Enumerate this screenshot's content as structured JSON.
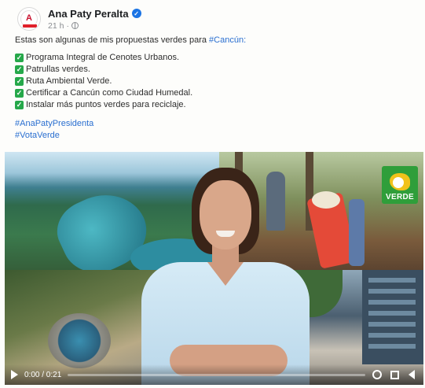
{
  "post": {
    "author": "Ana Paty Peralta",
    "timestamp": "21 h",
    "avatar_letter": "A",
    "verified_icon": "verified-check-icon",
    "privacy_icon": "globe-icon",
    "intro": "Estas son algunas de mis propuestas verdes para ",
    "intro_hashtag": "#Cancún:",
    "proposals": [
      "Programa Integral de Cenotes Urbanos.",
      "Patrullas verdes.",
      "Ruta Ambiental Verde.",
      "Certificar a Cancún como Ciudad Humedal.",
      "Instalar más puntos verdes para reciclaje."
    ],
    "hashtags": [
      "#AnaPatyPresidenta",
      "#VotaVerde"
    ]
  },
  "video": {
    "party_logo_text": "VERDE",
    "time": "0:00 / 0:21",
    "progress": 0.0,
    "controls": [
      "play-icon",
      "settings-gear-icon",
      "fullscreen-icon",
      "volume-icon"
    ]
  },
  "colors": {
    "hashtag": "#2a6fd0",
    "check": "#26a84a",
    "verified": "#1b74e4",
    "party_green": "#2f9e3a"
  }
}
